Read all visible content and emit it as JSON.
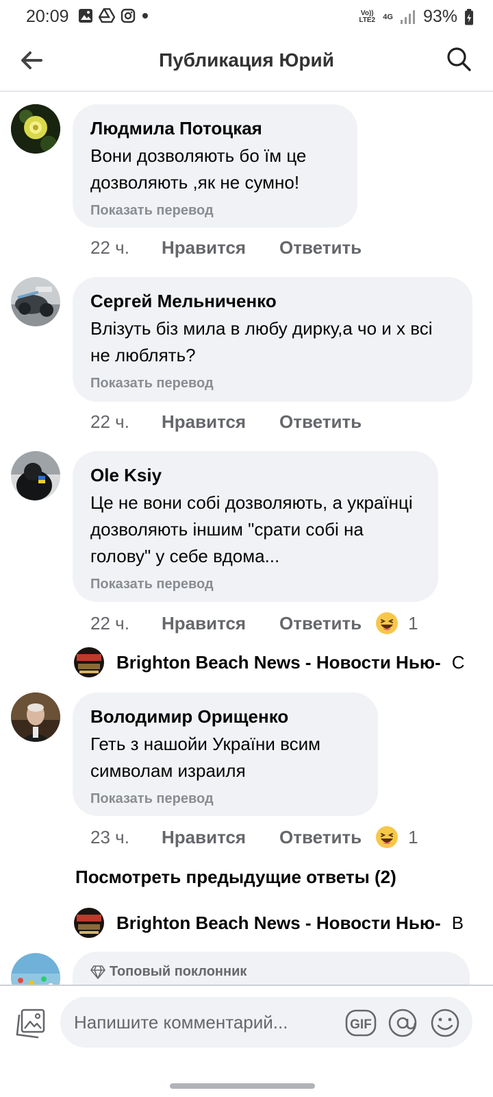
{
  "status_bar": {
    "time": "20:09",
    "left_icons": [
      "gallery-icon",
      "drive-icon",
      "instagram-icon",
      "dot-icon"
    ],
    "volte": "Vo)) LTE2",
    "network": "4G",
    "battery": "93%"
  },
  "header": {
    "title": "Публикация Юрий",
    "back_icon": "arrow-left-icon",
    "search_icon": "search-icon"
  },
  "comments": [
    {
      "author": "Людмила Потоцкая",
      "text": "Вони дозволяють бо їм це дозволяють ,як не сумно!",
      "translate": "Показать перевод",
      "time": "22 ч.",
      "like": "Нравится",
      "reply": "Ответить"
    },
    {
      "author": "Сергей Мельниченко",
      "text": "Влізуть біз мила в любу дирку,а чо и х  всі не люблять?",
      "translate": "Показать перевод",
      "time": "22 ч.",
      "like": "Нравится",
      "reply": "Ответить"
    },
    {
      "author": "Ole Ksiy",
      "text": "Це не вони собі дозволяють, а українці дозволяють іншим \"срати собі на голову\" у себе вдома...",
      "translate": "Показать перевод",
      "time": "22 ч.",
      "like": "Нравится",
      "reply": "Ответить",
      "reaction_count": "1",
      "reply_preview": {
        "author": "Brighton Beach News - Новости Нью-",
        "snippet": "С"
      }
    },
    {
      "author": "Володимир Орищенко",
      "text": "Геть з нашойи України всим символам израиля",
      "translate": "Показать перевод",
      "time": "23 ч.",
      "like": "Нравится",
      "reply": "Ответить",
      "reaction_count": "1",
      "more_replies": "Посмотреть предыдущие ответы (2)",
      "reply_preview": {
        "author": "Brighton Beach News - Новости Нью-",
        "snippet": "В"
      }
    },
    {
      "badge": "Топовый поклонник"
    }
  ],
  "composer": {
    "placeholder": "Напишите комментарий...",
    "gif_label": "GIF",
    "photo_icon": "photo-icon",
    "mention_icon": "at-icon",
    "emoji_icon": "smiley-icon"
  },
  "colors": {
    "bubble": "#f0f2f5",
    "secondary_text": "#65676b",
    "muted_text": "#8a8d91"
  }
}
